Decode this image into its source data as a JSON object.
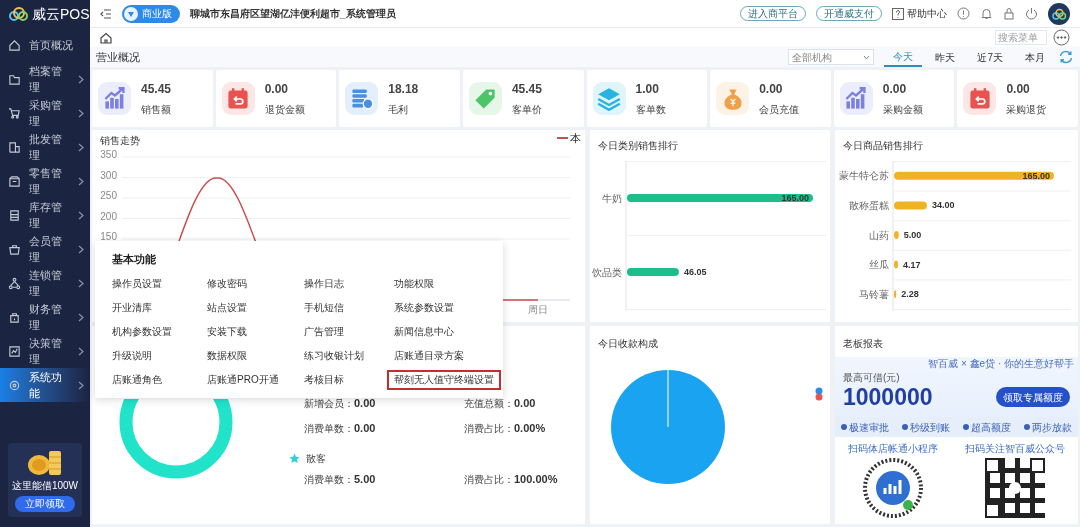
{
  "brand": {
    "name": "威云POS"
  },
  "sidebar": {
    "items": [
      {
        "label": "首页概况",
        "selected": false,
        "has_submenu": false
      },
      {
        "label": "档案管理",
        "selected": false,
        "has_submenu": true
      },
      {
        "label": "采购管理",
        "selected": false,
        "has_submenu": true
      },
      {
        "label": "批发管理",
        "selected": false,
        "has_submenu": true
      },
      {
        "label": "零售管理",
        "selected": false,
        "has_submenu": true
      },
      {
        "label": "库存管理",
        "selected": false,
        "has_submenu": true
      },
      {
        "label": "会员管理",
        "selected": false,
        "has_submenu": true
      },
      {
        "label": "连锁管理",
        "selected": false,
        "has_submenu": true
      },
      {
        "label": "财务管理",
        "selected": false,
        "has_submenu": true
      },
      {
        "label": "决策管理",
        "selected": false,
        "has_submenu": true
      },
      {
        "label": "系统功能",
        "selected": true,
        "has_submenu": true
      }
    ]
  },
  "promo": {
    "text": "这里能借100W",
    "button": "立即领取"
  },
  "topbar": {
    "edition": "商业版",
    "store": "聊城市东昌府区望湖亿沣便利超市_系统管理员",
    "links": [
      "进入商平台",
      "开通威支付"
    ],
    "help": "帮助中心"
  },
  "subbar": {
    "search": {
      "placeholder": "搜索菜单"
    }
  },
  "overview": {
    "title": "营业概况",
    "org_select": "全部机构",
    "ranges": [
      {
        "label": "今天",
        "selected": true
      },
      {
        "label": "昨天",
        "selected": false
      },
      {
        "label": "近7天",
        "selected": false
      },
      {
        "label": "本月",
        "selected": false
      }
    ]
  },
  "stats": [
    {
      "value": "45.45",
      "label": "销售额",
      "kind": "trend",
      "color": "#7b7fe0"
    },
    {
      "value": "0.00",
      "label": "退货金额",
      "kind": "return",
      "color": "#e8524f"
    },
    {
      "value": "18.18",
      "label": "毛利",
      "kind": "coins",
      "color": "#4a90e2"
    },
    {
      "value": "45.45",
      "label": "客单价",
      "kind": "tag",
      "color": "#4cc46a"
    },
    {
      "value": "1.00",
      "label": "客单数",
      "kind": "layers",
      "color": "#26b4e0"
    },
    {
      "value": "0.00",
      "label": "会员充值",
      "kind": "moneybag",
      "color": "#f0a04b"
    },
    {
      "value": "0.00",
      "label": "采购金额",
      "kind": "trend",
      "color": "#7b7fe0"
    },
    {
      "value": "0.00",
      "label": "采购退货",
      "kind": "return",
      "color": "#e8524f"
    }
  ],
  "sales_trend": {
    "title": "销售走势",
    "y_axis_labels": [
      "350",
      "300",
      "250",
      "200",
      "150"
    ],
    "x_axis_labels": [
      "周日"
    ],
    "legend": "本"
  },
  "category_ranking": {
    "title": "今日类别销售排行",
    "chart_data": {
      "type": "bar",
      "orientation": "horizontal",
      "categories": [
        "牛奶",
        "饮品类"
      ],
      "series": [
        {
          "color": "#1bbf8a",
          "values": [
            165.0,
            46.05
          ],
          "value_labels": [
            "165.00",
            "46.05"
          ]
        }
      ],
      "data_labels": true,
      "grid": true
    }
  },
  "product_ranking": {
    "title": "今日商品销售排行",
    "chart_data": {
      "type": "bar",
      "orientation": "horizontal",
      "categories": [
        "蒙牛特仑苏",
        "散称蛋糕",
        "山药",
        "丝瓜",
        "马铃薯"
      ],
      "series": [
        {
          "color": "#f0b323",
          "values": [
            165.0,
            34.0,
            5.0,
            4.17,
            2.28
          ],
          "value_labels": [
            "165.00",
            "34.00",
            "5.00",
            "4.17",
            "2.28"
          ]
        }
      ],
      "data_labels": true,
      "grid": true
    }
  },
  "member_panel": {
    "rows": [
      {
        "label": "新增会员：",
        "value": "0.00"
      },
      {
        "label": "充值总额：",
        "value": "0.00"
      },
      {
        "label": "消费单数：",
        "value": "0.00"
      },
      {
        "label": "消费占比：",
        "value": "0.00%"
      }
    ],
    "guest": {
      "label": "散客",
      "rows": [
        {
          "label": "消费单数：",
          "value": "5.00"
        },
        {
          "label": "消费占比：",
          "value": "100.00%"
        }
      ]
    }
  },
  "payments": {
    "title": "今日收款构成"
  },
  "boss_report": {
    "title": "老板报表",
    "ad": {
      "brand": "智百威 × 鑫e贷 · 你的生意好帮手",
      "caption": "最高可借(元)",
      "amount": "1000000",
      "button": "领取专属额度",
      "features": [
        "极速审批",
        "秒级到账",
        "超高额度",
        "两步放款"
      ],
      "qr_captions": [
        "扫码体店帐通小程序",
        "扫码关注智百威公众号"
      ]
    }
  },
  "menu_popup": {
    "title": "基本功能",
    "items": [
      {
        "label": "操作员设置",
        "highlighted": false
      },
      {
        "label": "修改密码",
        "highlighted": false
      },
      {
        "label": "操作日志",
        "highlighted": false
      },
      {
        "label": "功能权限",
        "highlighted": false
      },
      {
        "label": "开业清库",
        "highlighted": false
      },
      {
        "label": "站点设置",
        "highlighted": false
      },
      {
        "label": "手机短信",
        "highlighted": false
      },
      {
        "label": "系统参数设置",
        "highlighted": false
      },
      {
        "label": "机构参数设置",
        "highlighted": false
      },
      {
        "label": "安装下载",
        "highlighted": false
      },
      {
        "label": "广告管理",
        "highlighted": false
      },
      {
        "label": "新闻信息中心",
        "highlighted": false
      },
      {
        "label": "升级说明",
        "highlighted": false
      },
      {
        "label": "数据权限",
        "highlighted": false
      },
      {
        "label": "练习收银计划",
        "highlighted": false
      },
      {
        "label": "店账通目录方案",
        "highlighted": false
      },
      {
        "label": "店账通角色",
        "highlighted": false
      },
      {
        "label": "店账通PRO开通",
        "highlighted": false
      },
      {
        "label": "考核目标",
        "highlighted": false
      },
      {
        "label": "帮刻无人值守终端设置",
        "highlighted": true
      }
    ]
  }
}
